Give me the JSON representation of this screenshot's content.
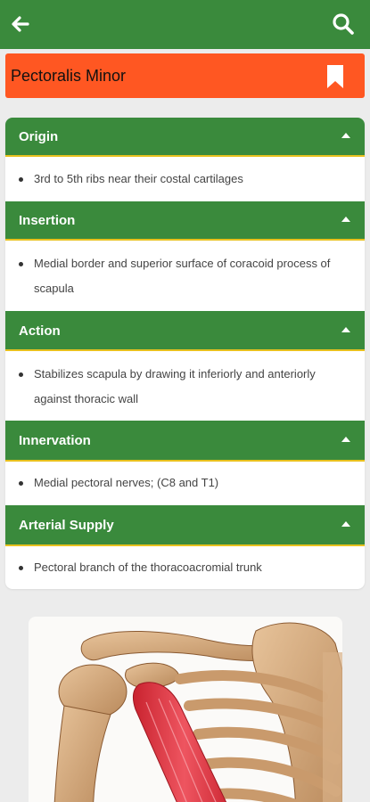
{
  "app": {
    "back_icon": "arrow-left-icon",
    "search_icon": "search-icon",
    "bar_color": "#3a8a3c"
  },
  "title_bar": {
    "title": "Pectoralis Minor",
    "bookmark_icon": "bookmark-icon",
    "color": "#ff5722"
  },
  "sections": [
    {
      "label": "Origin",
      "text": "3rd to 5th ribs near their costal cartilages"
    },
    {
      "label": "Insertion",
      "text": "Medial border and superior surface of coracoid process of scapula"
    },
    {
      "label": "Action",
      "text": "Stabilizes scapula by drawing it inferiorly and anteriorly against thoracic wall"
    },
    {
      "label": "Innervation",
      "text": "Medial pectoral nerves; (C8 and T1)"
    },
    {
      "label": "Arterial Supply",
      "text": "Pectoral branch of the thoracoacromial trunk"
    }
  ],
  "illustration": {
    "subject": "shoulder-anatomy-illustration"
  }
}
